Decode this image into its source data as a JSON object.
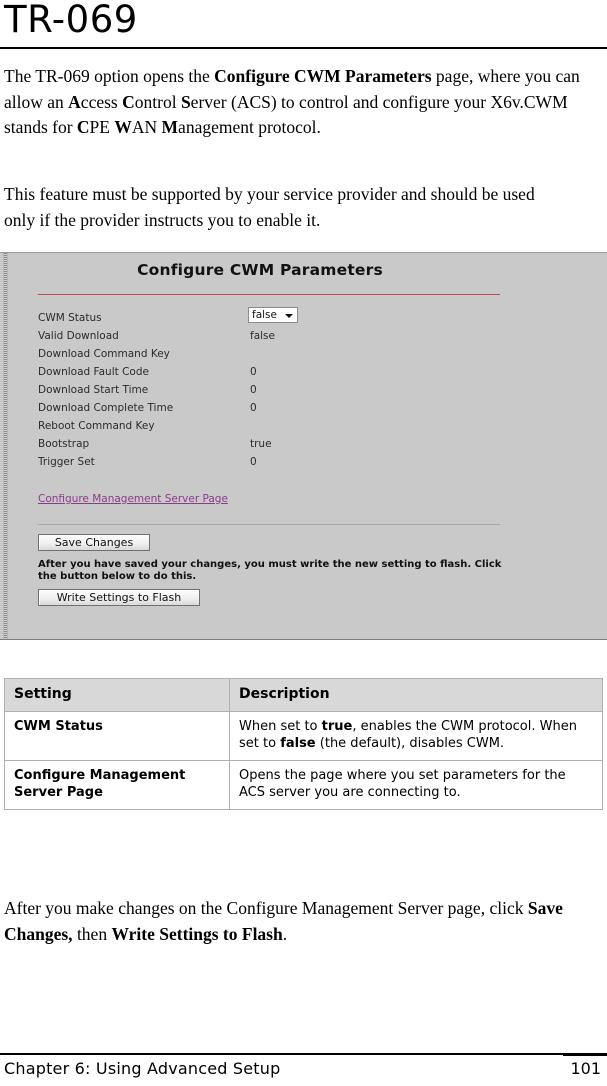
{
  "page": {
    "title": "TR-069"
  },
  "paragraphs": {
    "intro_parts": [
      {
        "text": "The TR-069 option opens the ",
        "bold": false
      },
      {
        "text": "Configure CWM Parameters",
        "bold": true
      },
      {
        "text": " page, where you can allow an ",
        "bold": false
      },
      {
        "text": "A",
        "bold": true
      },
      {
        "text": "ccess ",
        "bold": false
      },
      {
        "text": "C",
        "bold": true
      },
      {
        "text": "ontrol ",
        "bold": false
      },
      {
        "text": "S",
        "bold": true
      },
      {
        "text": "erver (ACS) to control and configure your X6v.CWM stands for  ",
        "bold": false
      },
      {
        "text": "C",
        "bold": true
      },
      {
        "text": "PE ",
        "bold": false
      },
      {
        "text": "W",
        "bold": true
      },
      {
        "text": "AN ",
        "bold": false
      },
      {
        "text": "M",
        "bold": true
      },
      {
        "text": "anagement protocol.",
        "bold": false
      }
    ],
    "support_note": "This feature must be supported by your service provider and should be used only if the provider instructs you to enable it.",
    "closing_parts": [
      {
        "text": "After you make changes on the Configure Management Server page, click ",
        "bold": false
      },
      {
        "text": "Save Changes,",
        "bold": true
      },
      {
        "text": " then ",
        "bold": false
      },
      {
        "text": "Write Settings to Flash",
        "bold": true
      },
      {
        "text": ".",
        "bold": false
      }
    ]
  },
  "screenshot": {
    "heading": "Configure CWM Parameters",
    "accent_rule_color": "#c14a4a",
    "background_color": "#c9c9c9",
    "link_color": "#8d3a8d",
    "fields": [
      {
        "label": "CWM Status",
        "value": "false",
        "control": "select"
      },
      {
        "label": "Valid Download",
        "value": "false",
        "control": "text"
      },
      {
        "label": "Download Command Key",
        "value": "",
        "control": "text"
      },
      {
        "label": "Download Fault Code",
        "value": "0",
        "control": "text"
      },
      {
        "label": "Download Start Time",
        "value": "0",
        "control": "text"
      },
      {
        "label": "Download Complete Time",
        "value": "0",
        "control": "text"
      },
      {
        "label": "Reboot Command Key",
        "value": "",
        "control": "text"
      },
      {
        "label": "Bootstrap",
        "value": "true",
        "control": "text"
      },
      {
        "label": "Trigger Set",
        "value": "0",
        "control": "text"
      }
    ],
    "link_label": "Configure Management Server Page",
    "save_button": "Save Changes",
    "flash_note": "After you have saved your changes, you must write the new setting to flash. Click the button below to do this.",
    "flash_button": "Write Settings to Flash"
  },
  "table": {
    "headers": [
      "Setting",
      "Description"
    ],
    "rows": [
      {
        "setting": "CWM Status",
        "description_parts": [
          {
            "text": "When set to ",
            "bold": false
          },
          {
            "text": "true",
            "bold": true
          },
          {
            "text": ", enables the CWM protocol. When set to ",
            "bold": false
          },
          {
            "text": "false",
            "bold": true
          },
          {
            "text": " (the default), disables CWM.",
            "bold": false
          }
        ]
      },
      {
        "setting": "Configure Management Server Page",
        "description_parts": [
          {
            "text": "Opens the page where you set parameters for the ACS server you are connecting to.",
            "bold": false
          }
        ]
      }
    ]
  },
  "footer": {
    "chapter": "Chapter 6: Using Advanced Setup",
    "page_number": "101"
  }
}
